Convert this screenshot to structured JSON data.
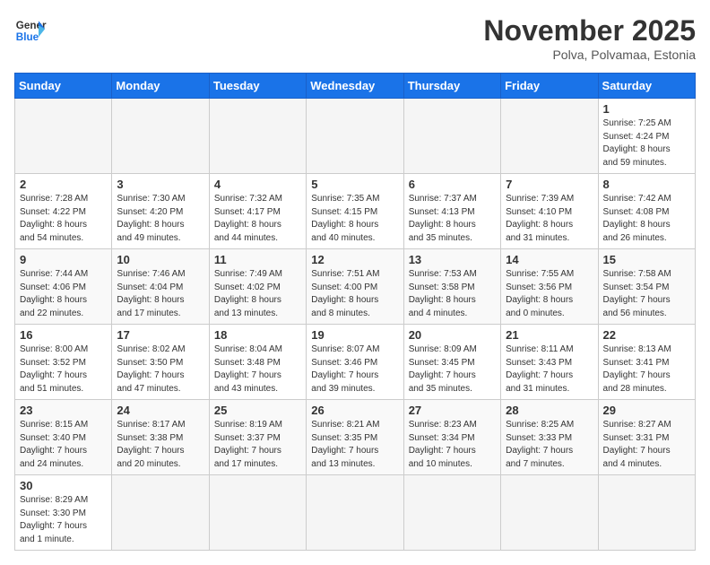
{
  "header": {
    "logo_general": "General",
    "logo_blue": "Blue",
    "month_title": "November 2025",
    "location": "Polva, Polvamaa, Estonia"
  },
  "weekdays": [
    "Sunday",
    "Monday",
    "Tuesday",
    "Wednesday",
    "Thursday",
    "Friday",
    "Saturday"
  ],
  "weeks": [
    {
      "shade": false,
      "days": [
        {
          "num": "",
          "info": ""
        },
        {
          "num": "",
          "info": ""
        },
        {
          "num": "",
          "info": ""
        },
        {
          "num": "",
          "info": ""
        },
        {
          "num": "",
          "info": ""
        },
        {
          "num": "",
          "info": ""
        },
        {
          "num": "1",
          "info": "Sunrise: 7:25 AM\nSunset: 4:24 PM\nDaylight: 8 hours\nand 59 minutes."
        }
      ]
    },
    {
      "shade": false,
      "days": [
        {
          "num": "2",
          "info": "Sunrise: 7:28 AM\nSunset: 4:22 PM\nDaylight: 8 hours\nand 54 minutes."
        },
        {
          "num": "3",
          "info": "Sunrise: 7:30 AM\nSunset: 4:20 PM\nDaylight: 8 hours\nand 49 minutes."
        },
        {
          "num": "4",
          "info": "Sunrise: 7:32 AM\nSunset: 4:17 PM\nDaylight: 8 hours\nand 44 minutes."
        },
        {
          "num": "5",
          "info": "Sunrise: 7:35 AM\nSunset: 4:15 PM\nDaylight: 8 hours\nand 40 minutes."
        },
        {
          "num": "6",
          "info": "Sunrise: 7:37 AM\nSunset: 4:13 PM\nDaylight: 8 hours\nand 35 minutes."
        },
        {
          "num": "7",
          "info": "Sunrise: 7:39 AM\nSunset: 4:10 PM\nDaylight: 8 hours\nand 31 minutes."
        },
        {
          "num": "8",
          "info": "Sunrise: 7:42 AM\nSunset: 4:08 PM\nDaylight: 8 hours\nand 26 minutes."
        }
      ]
    },
    {
      "shade": true,
      "days": [
        {
          "num": "9",
          "info": "Sunrise: 7:44 AM\nSunset: 4:06 PM\nDaylight: 8 hours\nand 22 minutes."
        },
        {
          "num": "10",
          "info": "Sunrise: 7:46 AM\nSunset: 4:04 PM\nDaylight: 8 hours\nand 17 minutes."
        },
        {
          "num": "11",
          "info": "Sunrise: 7:49 AM\nSunset: 4:02 PM\nDaylight: 8 hours\nand 13 minutes."
        },
        {
          "num": "12",
          "info": "Sunrise: 7:51 AM\nSunset: 4:00 PM\nDaylight: 8 hours\nand 8 minutes."
        },
        {
          "num": "13",
          "info": "Sunrise: 7:53 AM\nSunset: 3:58 PM\nDaylight: 8 hours\nand 4 minutes."
        },
        {
          "num": "14",
          "info": "Sunrise: 7:55 AM\nSunset: 3:56 PM\nDaylight: 8 hours\nand 0 minutes."
        },
        {
          "num": "15",
          "info": "Sunrise: 7:58 AM\nSunset: 3:54 PM\nDaylight: 7 hours\nand 56 minutes."
        }
      ]
    },
    {
      "shade": false,
      "days": [
        {
          "num": "16",
          "info": "Sunrise: 8:00 AM\nSunset: 3:52 PM\nDaylight: 7 hours\nand 51 minutes."
        },
        {
          "num": "17",
          "info": "Sunrise: 8:02 AM\nSunset: 3:50 PM\nDaylight: 7 hours\nand 47 minutes."
        },
        {
          "num": "18",
          "info": "Sunrise: 8:04 AM\nSunset: 3:48 PM\nDaylight: 7 hours\nand 43 minutes."
        },
        {
          "num": "19",
          "info": "Sunrise: 8:07 AM\nSunset: 3:46 PM\nDaylight: 7 hours\nand 39 minutes."
        },
        {
          "num": "20",
          "info": "Sunrise: 8:09 AM\nSunset: 3:45 PM\nDaylight: 7 hours\nand 35 minutes."
        },
        {
          "num": "21",
          "info": "Sunrise: 8:11 AM\nSunset: 3:43 PM\nDaylight: 7 hours\nand 31 minutes."
        },
        {
          "num": "22",
          "info": "Sunrise: 8:13 AM\nSunset: 3:41 PM\nDaylight: 7 hours\nand 28 minutes."
        }
      ]
    },
    {
      "shade": true,
      "days": [
        {
          "num": "23",
          "info": "Sunrise: 8:15 AM\nSunset: 3:40 PM\nDaylight: 7 hours\nand 24 minutes."
        },
        {
          "num": "24",
          "info": "Sunrise: 8:17 AM\nSunset: 3:38 PM\nDaylight: 7 hours\nand 20 minutes."
        },
        {
          "num": "25",
          "info": "Sunrise: 8:19 AM\nSunset: 3:37 PM\nDaylight: 7 hours\nand 17 minutes."
        },
        {
          "num": "26",
          "info": "Sunrise: 8:21 AM\nSunset: 3:35 PM\nDaylight: 7 hours\nand 13 minutes."
        },
        {
          "num": "27",
          "info": "Sunrise: 8:23 AM\nSunset: 3:34 PM\nDaylight: 7 hours\nand 10 minutes."
        },
        {
          "num": "28",
          "info": "Sunrise: 8:25 AM\nSunset: 3:33 PM\nDaylight: 7 hours\nand 7 minutes."
        },
        {
          "num": "29",
          "info": "Sunrise: 8:27 AM\nSunset: 3:31 PM\nDaylight: 7 hours\nand 4 minutes."
        }
      ]
    },
    {
      "shade": false,
      "days": [
        {
          "num": "30",
          "info": "Sunrise: 8:29 AM\nSunset: 3:30 PM\nDaylight: 7 hours\nand 1 minute."
        },
        {
          "num": "",
          "info": ""
        },
        {
          "num": "",
          "info": ""
        },
        {
          "num": "",
          "info": ""
        },
        {
          "num": "",
          "info": ""
        },
        {
          "num": "",
          "info": ""
        },
        {
          "num": "",
          "info": ""
        }
      ]
    }
  ]
}
